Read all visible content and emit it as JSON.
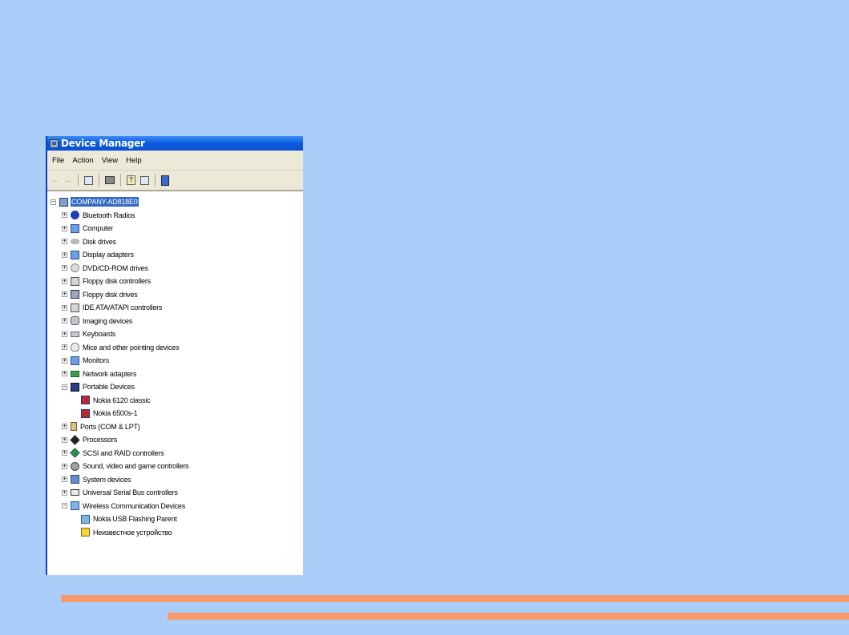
{
  "window": {
    "title": "Device Manager",
    "menu": [
      "File",
      "Action",
      "View",
      "Help"
    ],
    "toolbar_icons": [
      "back-arrow-icon",
      "forward-arrow-icon",
      "properties-box-icon",
      "print-icon",
      "help-icon",
      "view-box-icon",
      "device-icon"
    ]
  },
  "tree": {
    "root": "COMPANY-AD818E0",
    "items": [
      {
        "label": "Bluetooth Radios",
        "icon": "bluetooth-icon",
        "expanded": false
      },
      {
        "label": "Computer",
        "icon": "computer-icon",
        "expanded": false
      },
      {
        "label": "Disk drives",
        "icon": "disk-drive-icon",
        "expanded": false
      },
      {
        "label": "Display adapters",
        "icon": "display-adapter-icon",
        "expanded": false
      },
      {
        "label": "DVD/CD-ROM drives",
        "icon": "cdrom-icon",
        "expanded": false
      },
      {
        "label": "Floppy disk controllers",
        "icon": "floppy-controller-icon",
        "expanded": false
      },
      {
        "label": "Floppy disk drives",
        "icon": "floppy-drive-icon",
        "expanded": false
      },
      {
        "label": "IDE ATA/ATAPI controllers",
        "icon": "ide-controller-icon",
        "expanded": false
      },
      {
        "label": "Imaging devices",
        "icon": "camera-icon",
        "expanded": false
      },
      {
        "label": "Keyboards",
        "icon": "keyboard-icon",
        "expanded": false
      },
      {
        "label": "Mice and other pointing devices",
        "icon": "mouse-icon",
        "expanded": false
      },
      {
        "label": "Monitors",
        "icon": "monitor-icon",
        "expanded": false
      },
      {
        "label": "Network adapters",
        "icon": "network-adapter-icon",
        "expanded": false
      },
      {
        "label": "Portable Devices",
        "icon": "portable-device-icon",
        "expanded": true,
        "children": [
          {
            "label": "Nokia 6120 classic",
            "icon": "nokia-phone-icon"
          },
          {
            "label": "Nokia 6500s-1",
            "icon": "nokia-phone-icon"
          }
        ]
      },
      {
        "label": "Ports (COM & LPT)",
        "icon": "port-icon",
        "expanded": false
      },
      {
        "label": "Processors",
        "icon": "processor-icon",
        "expanded": false
      },
      {
        "label": "SCSI and RAID controllers",
        "icon": "scsi-icon",
        "expanded": false
      },
      {
        "label": "Sound, video and game controllers",
        "icon": "sound-icon",
        "expanded": false
      },
      {
        "label": "System devices",
        "icon": "system-device-icon",
        "expanded": false
      },
      {
        "label": "Universal Serial Bus controllers",
        "icon": "usb-icon",
        "expanded": false
      },
      {
        "label": "Wireless Communication Devices",
        "icon": "wireless-icon",
        "expanded": true,
        "children": [
          {
            "label": "Nokia USB Flashing Parent",
            "icon": "wireless-device-icon"
          },
          {
            "label": "Неизвестное устройство",
            "icon": "unknown-device-warning-icon"
          }
        ]
      }
    ]
  },
  "colors": {
    "background": "#aacdf9",
    "accent_stripe": "#f79a6c",
    "titlebar": "#0d5fe0",
    "selection": "#316ac5"
  }
}
